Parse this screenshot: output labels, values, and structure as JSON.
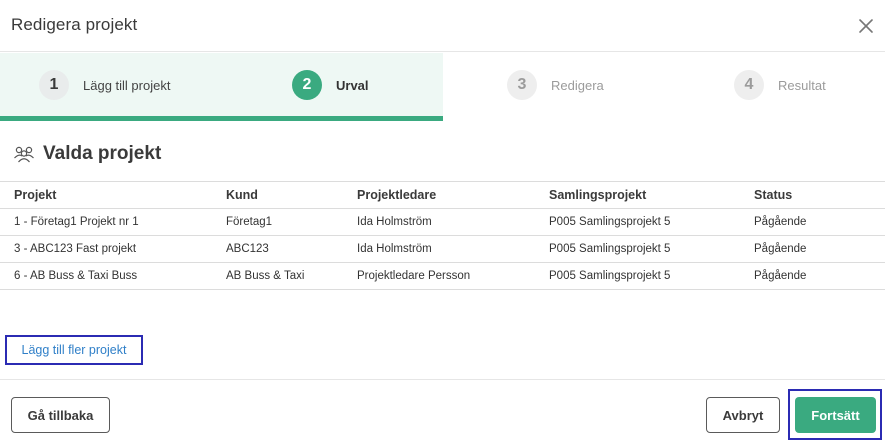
{
  "modal": {
    "title": "Redigera projekt"
  },
  "steps": [
    {
      "num": "1",
      "label": "Lägg till projekt",
      "state": "done"
    },
    {
      "num": "2",
      "label": "Urval",
      "state": "active"
    },
    {
      "num": "3",
      "label": "Redigera",
      "state": "todo"
    },
    {
      "num": "4",
      "label": "Resultat",
      "state": "todo"
    }
  ],
  "section": {
    "title": "Valda projekt",
    "icon": "users-icon"
  },
  "table": {
    "headers": [
      "Projekt",
      "Kund",
      "Projektledare",
      "Samlingsprojekt",
      "Status"
    ],
    "rows": [
      [
        "1 - Företag1 Projekt nr 1",
        "Företag1",
        "Ida Holmström",
        "P005 Samlingsprojekt 5",
        "Pågående"
      ],
      [
        "3 - ABC123 Fast projekt",
        "ABC123",
        "Ida Holmström",
        "P005 Samlingsprojekt 5",
        "Pågående"
      ],
      [
        "6 - AB Buss & Taxi Buss",
        "AB Buss & Taxi",
        "Projektledare Persson",
        "P005 Samlingsprojekt 5",
        "Pågående"
      ]
    ]
  },
  "actions": {
    "add_more": "Lägg till fler projekt",
    "back": "Gå tillbaka",
    "cancel": "Avbryt",
    "continue": "Fortsätt"
  },
  "colors": {
    "accent": "#3aaa80",
    "active_step_bg": "#eef8f4",
    "link": "#2f7fc8",
    "focus": "#2b2bb3"
  }
}
